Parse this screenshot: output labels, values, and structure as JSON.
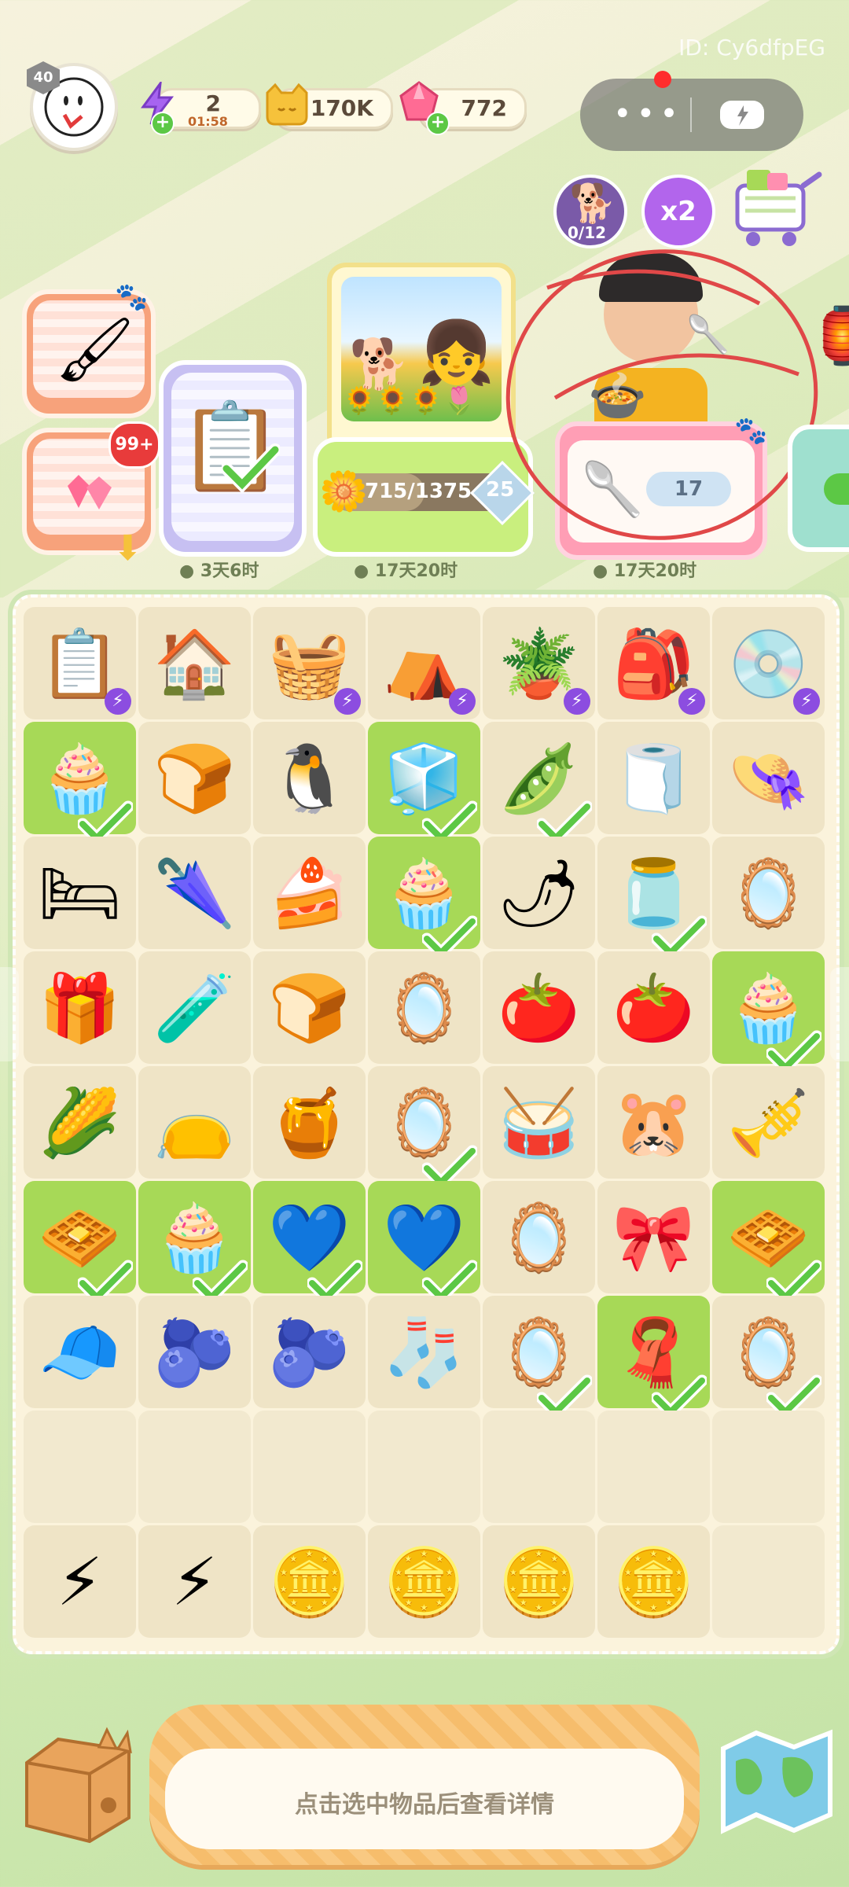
{
  "header": {
    "level": "40",
    "energy": {
      "value": "2",
      "timer": "01:58"
    },
    "coins": {
      "value": "170K"
    },
    "gems": {
      "value": "772"
    },
    "user_id": "ID: Cy6dfpEG"
  },
  "top_buttons": {
    "pet_counter": "0/12",
    "multiplier": "x2"
  },
  "orders": {
    "badge_99": "99+",
    "task_timer": "3天6时",
    "event_progress": "715/1375",
    "event_level": "25",
    "event_timer": "17天20时",
    "character_need": "17",
    "character_timer": "17天20时"
  },
  "board": {
    "rows": [
      [
        {
          "g": "📋",
          "s": "t"
        },
        {
          "g": "🏠",
          "s": ""
        },
        {
          "g": "🧺",
          "s": "t"
        },
        {
          "g": "⛺",
          "s": "t"
        },
        {
          "g": "🪴",
          "s": "t"
        },
        {
          "g": "🎒",
          "s": "t"
        },
        {
          "g": "💿",
          "s": "t"
        }
      ],
      [
        {
          "g": "🧁",
          "s": "d"
        },
        {
          "g": "🍞",
          "s": ""
        },
        {
          "g": "🐧",
          "s": ""
        },
        {
          "g": "🧊",
          "s": "d"
        },
        {
          "g": "🫛",
          "s": "c"
        },
        {
          "g": "🧻",
          "s": ""
        },
        {
          "g": "👒",
          "s": ""
        }
      ],
      [
        {
          "g": "🛏",
          "s": ""
        },
        {
          "g": "🌂",
          "s": ""
        },
        {
          "g": "🍰",
          "s": ""
        },
        {
          "g": "🧁",
          "s": "d"
        },
        {
          "g": "🌶",
          "s": ""
        },
        {
          "g": "🫙",
          "s": "c"
        },
        {
          "g": "🪞",
          "s": ""
        }
      ],
      [
        {
          "g": "🎁",
          "s": ""
        },
        {
          "g": "🧪",
          "s": ""
        },
        {
          "g": "🍞",
          "s": ""
        },
        {
          "g": "🪞",
          "s": ""
        },
        {
          "g": "🍅",
          "s": ""
        },
        {
          "g": "🍅",
          "s": ""
        },
        {
          "g": "🧁",
          "s": "d"
        }
      ],
      [
        {
          "g": "🌽",
          "s": ""
        },
        {
          "g": "👝",
          "s": ""
        },
        {
          "g": "🍯",
          "s": ""
        },
        {
          "g": "🪞",
          "s": "c"
        },
        {
          "g": "🥁",
          "s": ""
        },
        {
          "g": "🐹",
          "s": ""
        },
        {
          "g": "🎺",
          "s": ""
        }
      ],
      [
        {
          "g": "🧇",
          "s": "d"
        },
        {
          "g": "🧁",
          "s": "d"
        },
        {
          "g": "💙",
          "s": "d"
        },
        {
          "g": "💙",
          "s": "d"
        },
        {
          "g": "🪞",
          "s": ""
        },
        {
          "g": "🎀",
          "s": ""
        },
        {
          "g": "🧇",
          "s": "d"
        }
      ],
      [
        {
          "g": "🧢",
          "s": ""
        },
        {
          "g": "🫐",
          "s": ""
        },
        {
          "g": "🫐",
          "s": ""
        },
        {
          "g": "🧦",
          "s": ""
        },
        {
          "g": "🪞",
          "s": "c"
        },
        {
          "g": "🧣",
          "s": "d"
        },
        {
          "g": "🪞",
          "s": "c"
        }
      ],
      [
        {
          "g": "",
          "s": "e"
        },
        {
          "g": "",
          "s": "e"
        },
        {
          "g": "",
          "s": "e"
        },
        {
          "g": "",
          "s": "e"
        },
        {
          "g": "",
          "s": "e"
        },
        {
          "g": "",
          "s": "e"
        },
        {
          "g": "",
          "s": "e"
        }
      ],
      [
        {
          "g": "⚡",
          "s": ""
        },
        {
          "g": "⚡",
          "s": ""
        },
        {
          "g": "🪙",
          "s": ""
        },
        {
          "g": "🪙",
          "s": ""
        },
        {
          "g": "🪙",
          "s": ""
        },
        {
          "g": "🪙",
          "s": ""
        },
        {
          "g": "",
          "s": "e"
        }
      ]
    ]
  },
  "bottom": {
    "hint": "点击选中物品后查看详情"
  },
  "colors": {
    "done": "#a7d957",
    "check": "#5cc845",
    "energy": "#9b59e6",
    "coin": "#f5c23a",
    "gem": "#ff5c8a"
  }
}
